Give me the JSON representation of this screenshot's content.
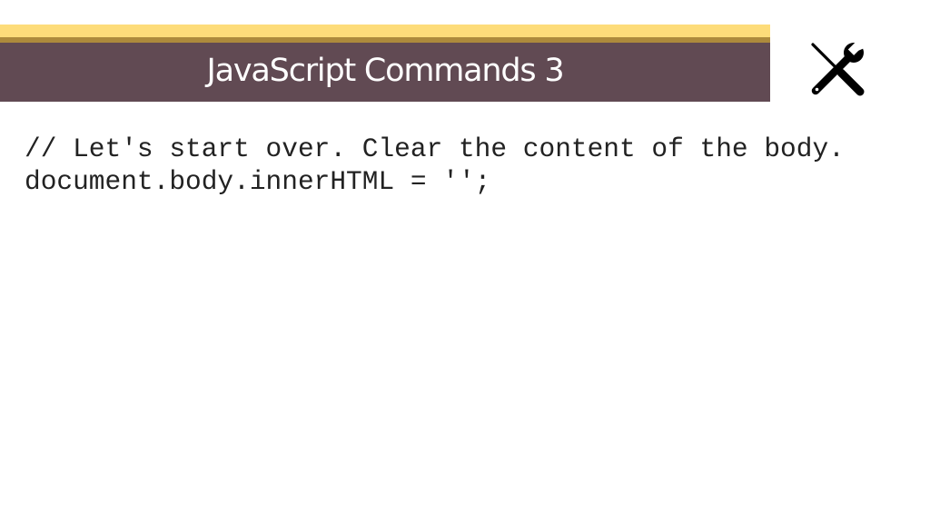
{
  "slide": {
    "title": "JavaScript Commands 3",
    "icon": "tools-icon",
    "code_lines": [
      "// Let's start over. Clear the content of the body.",
      "document.body.innerHTML = '';"
    ]
  },
  "colors": {
    "banner_top": "#fddc7a",
    "banner_rule": "#ad8a3c",
    "banner_bg": "#614a53",
    "title_text": "#ffffff",
    "code_text": "#222222",
    "icon": "#000000"
  }
}
